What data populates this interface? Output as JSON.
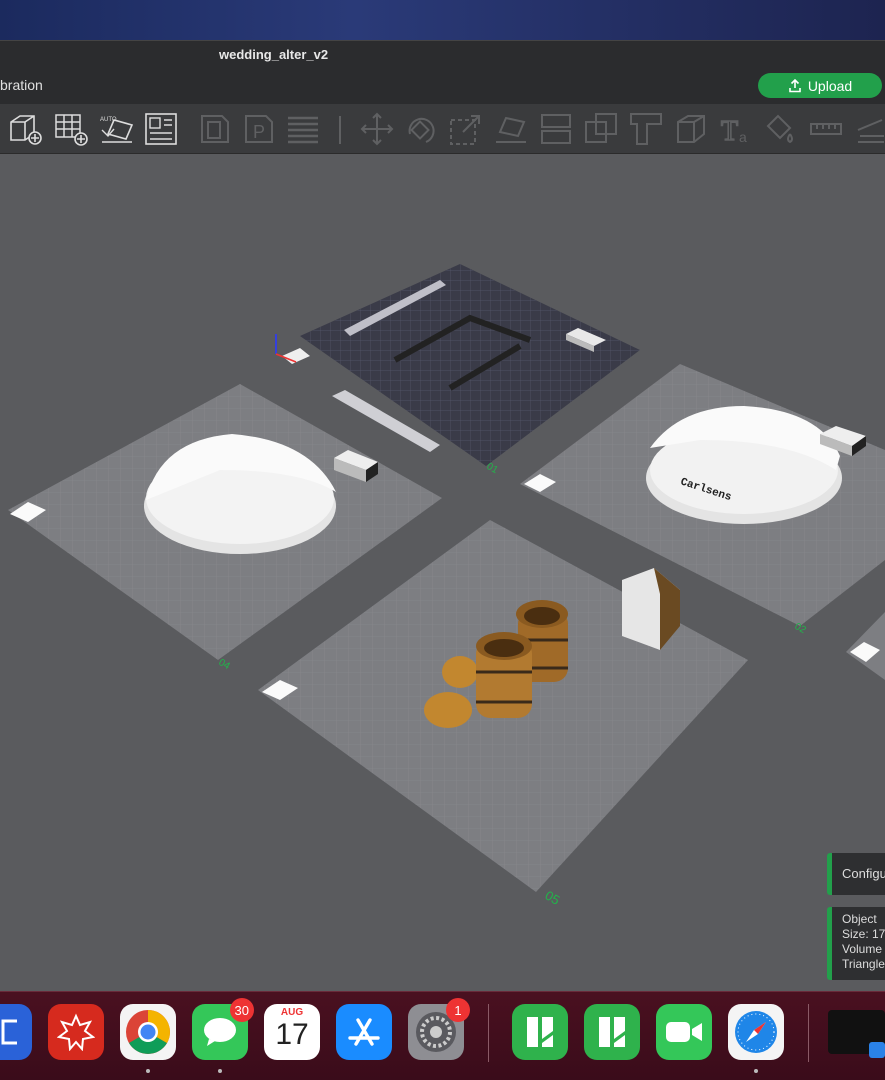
{
  "window": {
    "title": "wedding_alter_v2"
  },
  "menubar": {
    "tab_label": "bration",
    "upload_label": "Upload"
  },
  "toolbar": {
    "tools": [
      "add-object-icon",
      "add-grid-icon",
      "auto-orient-icon",
      "arrange-icon",
      "plate-icon",
      "plate-p-icon",
      "layers-icon",
      "move-icon",
      "rotate-icon",
      "scale-icon",
      "lay-flat-icon",
      "cut-icon",
      "split-icon",
      "boolean-icon",
      "support-icon",
      "text-icon",
      "paint-icon",
      "measure-icon",
      "assemble-icon"
    ]
  },
  "plates": {
    "labels": [
      "01",
      "02",
      "04",
      "05"
    ],
    "text_on_object": "Carlsens"
  },
  "notifications": {
    "config_label": "Configu",
    "object_info": [
      "Object ",
      "Size: 17",
      "Volume",
      "Triangle"
    ]
  },
  "dock": {
    "apps": [
      {
        "name": "code-editor",
        "color": "#2a62d8"
      },
      {
        "name": "wolfram",
        "color": "#d62a1e"
      },
      {
        "name": "chrome",
        "color": "#f4f4f4"
      },
      {
        "name": "messages",
        "color": "#34c759",
        "badge": "30"
      },
      {
        "name": "calendar",
        "color": "#ffffff",
        "month": "AUG",
        "day": "17"
      },
      {
        "name": "app-store",
        "color": "#1a8cff"
      },
      {
        "name": "system-settings",
        "color": "#8e8e93",
        "badge": "1"
      },
      {
        "name": "bambu-studio",
        "color": "#2fb24c"
      },
      {
        "name": "bambu-handy",
        "color": "#2fb24c"
      },
      {
        "name": "facetime",
        "color": "#34c759"
      },
      {
        "name": "safari",
        "color": "#f4f4f4"
      }
    ]
  }
}
